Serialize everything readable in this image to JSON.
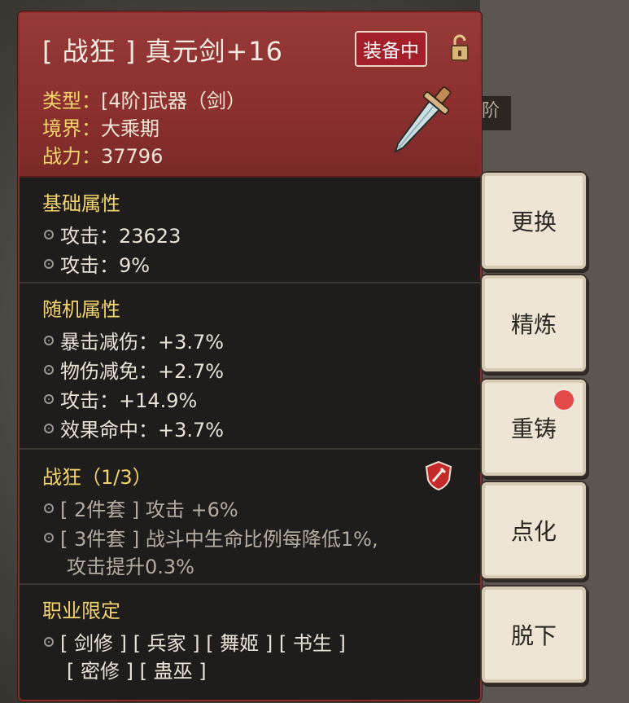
{
  "item": {
    "title": "[ 战狂 ] 真元剑+16",
    "equipped_badge": "装备中",
    "type_label": "类型：",
    "type_value": "[4阶]武器（剑）",
    "realm_label": "境界：",
    "realm_value": "大乘期",
    "power_label": "战力：",
    "power_value": "37796"
  },
  "base_attrs": {
    "title": "基础属性",
    "lines": [
      "攻击：23623",
      "攻击：9%"
    ]
  },
  "random_attrs": {
    "title": "随机属性",
    "lines": [
      "暴击减伤：+3.7%",
      "物伤减免：+2.7%",
      "攻击：+14.9%",
      "效果命中：+3.7%"
    ]
  },
  "set_bonus": {
    "title": "战狂（1/3）",
    "line1": "[ 2件套 ] 攻击 +6%",
    "line2a": "[ 3件套 ] 战斗中生命比例每降低1%,",
    "line2b": "攻击提升0.3%"
  },
  "class_limit": {
    "title": "职业限定",
    "line1": "[ 剑修 ] [ 兵家 ] [ 舞姬 ] [ 书生 ]",
    "line2": "[ 密修 ] [ 蛊巫 ]"
  },
  "actions": [
    "更换",
    "精炼",
    "重铸",
    "点化",
    "脱下"
  ],
  "background": {
    "tab_text": "阶"
  },
  "colors": {
    "header_red": "#8a2f2e",
    "label_gold": "#f2d46d",
    "badge_red": "#a31f2a"
  }
}
